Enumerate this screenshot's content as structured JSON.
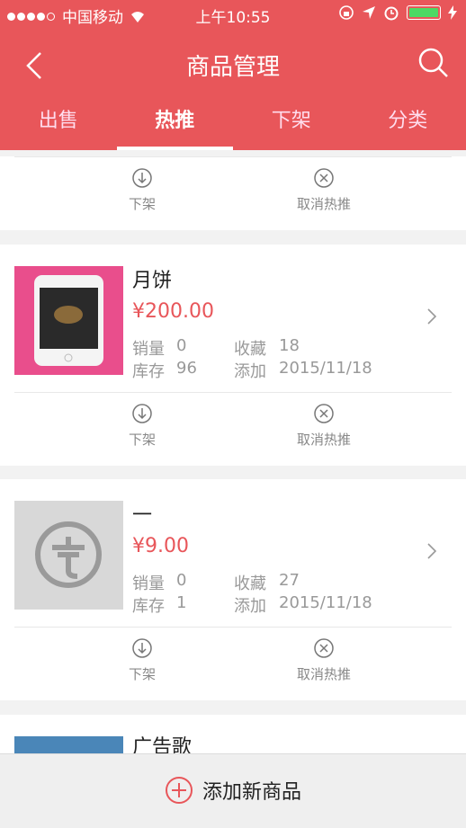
{
  "status": {
    "carrier": "中国移动",
    "time": "上午10:55"
  },
  "nav": {
    "title": "商品管理"
  },
  "tabs": [
    "出售",
    "热推",
    "下架",
    "分类"
  ],
  "actions": {
    "offshelf": "下架",
    "cancel_hot": "取消热推"
  },
  "products": [
    {
      "name": "月饼",
      "price": "¥200.00",
      "sales_label": "销量",
      "sales": "0",
      "fav_label": "收藏",
      "fav": "18",
      "stock_label": "库存",
      "stock": "96",
      "added_label": "添加",
      "added": "2015/11/18"
    },
    {
      "name": "一",
      "price": "¥9.00",
      "sales_label": "销量",
      "sales": "0",
      "fav_label": "收藏",
      "fav": "27",
      "stock_label": "库存",
      "stock": "1",
      "added_label": "添加",
      "added": "2015/11/18"
    },
    {
      "name": "广告歌"
    }
  ],
  "bottom": {
    "add_label": "添加新商品"
  },
  "colors": {
    "brand": "#e8565a",
    "bg": "#f2f2f2"
  }
}
